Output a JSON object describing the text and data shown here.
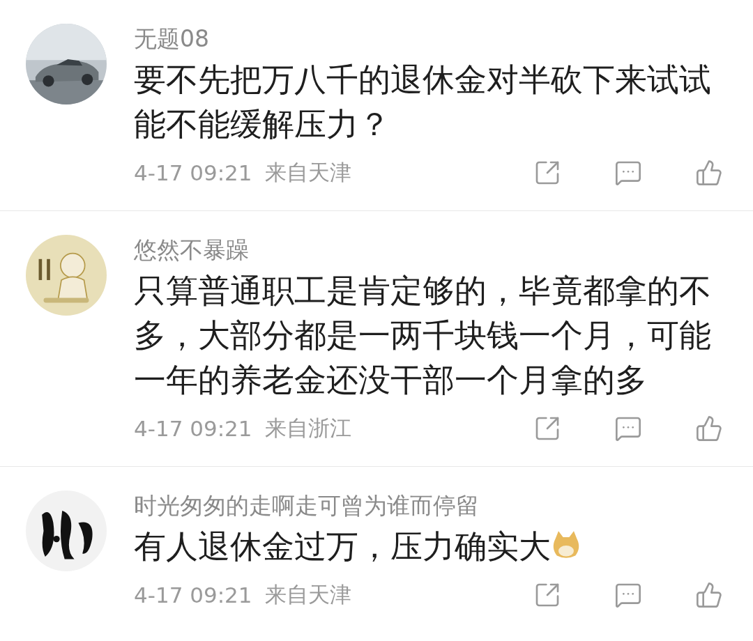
{
  "comments": [
    {
      "username": "无题08",
      "text": "要不先把万八千的退休金对半砍下来试试能不能缓解压力？",
      "time": "4-17 09:21",
      "location": "来自天津",
      "trailing_emoji": false
    },
    {
      "username": "悠然不暴躁",
      "text": "只算普通职工是肯定够的，毕竟都拿的不多，大部分都是一两千块钱一个月，可能一年的养老金还没干部一个月拿的多",
      "time": "4-17 09:21",
      "location": "来自浙江",
      "trailing_emoji": false
    },
    {
      "username": "时光匆匆的走啊走可曾为谁而停留",
      "text": "有人退休金过万，压力确实大",
      "time": "4-17 09:21",
      "location": "来自天津",
      "trailing_emoji": true
    }
  ]
}
